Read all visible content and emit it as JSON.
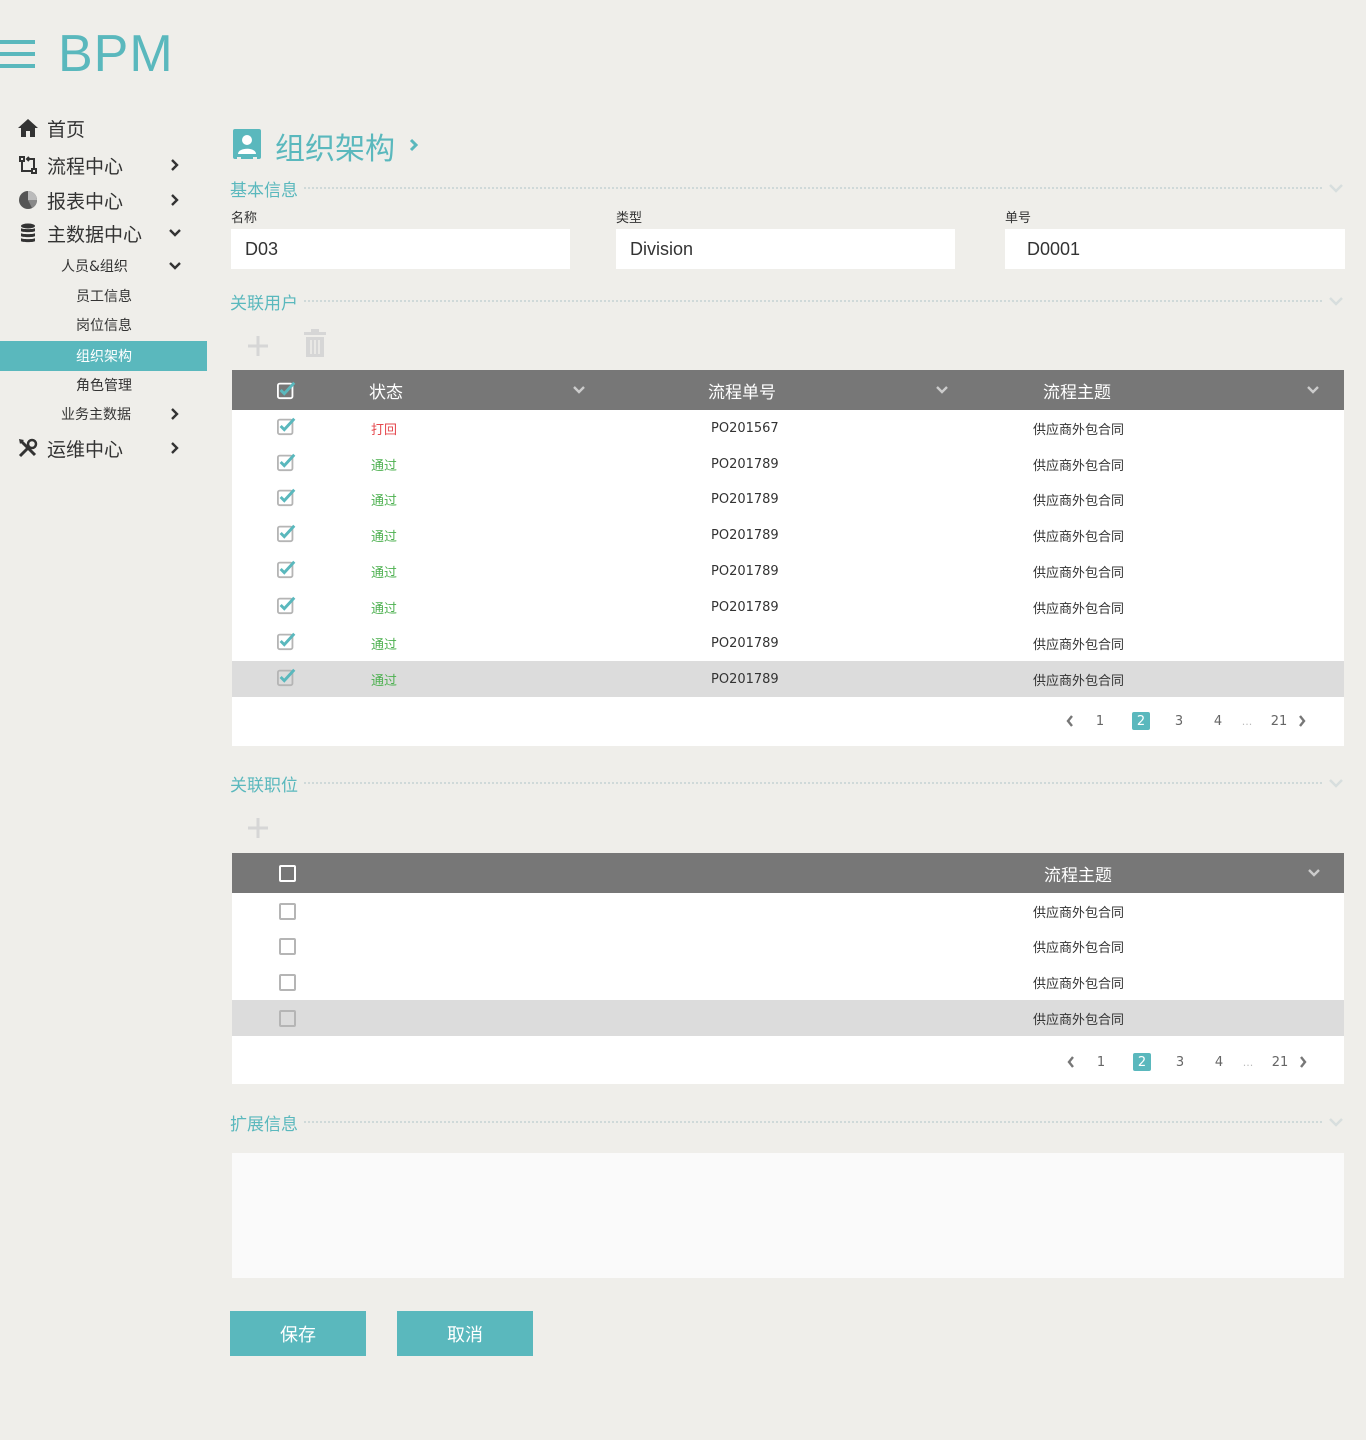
{
  "app": {
    "logo": "BPM"
  },
  "sidebar": {
    "items": [
      {
        "label": "首页",
        "icon": "home-icon"
      },
      {
        "label": "流程中心",
        "icon": "workflow-icon"
      },
      {
        "label": "报表中心",
        "icon": "pie-chart-icon"
      },
      {
        "label": "主数据中心",
        "icon": "database-icon"
      },
      {
        "label": "人员&组织"
      },
      {
        "label": "员工信息"
      },
      {
        "label": "岗位信息"
      },
      {
        "label": "组织架构",
        "active": true
      },
      {
        "label": "角色管理"
      },
      {
        "label": "业务主数据"
      },
      {
        "label": "运维中心",
        "icon": "tools-icon"
      }
    ]
  },
  "page": {
    "title": "组织架构"
  },
  "sections": {
    "basic": "基本信息",
    "users": "关联用户",
    "positions": "关联职位",
    "extension": "扩展信息"
  },
  "form": {
    "name_label": "名称",
    "name_value": "D03",
    "type_label": "类型",
    "type_value": "Division",
    "number_label": "单号",
    "number_value": "D0001"
  },
  "users_table": {
    "headers": {
      "status": "状态",
      "number": "流程单号",
      "subject": "流程主题"
    },
    "rows": [
      {
        "status": "打回",
        "status_color": "#e5484d",
        "number": "PO201567",
        "subject": "供应商外包合同",
        "checked": true
      },
      {
        "status": "通过",
        "status_color": "#4cb04f",
        "number": "PO201789",
        "subject": "供应商外包合同",
        "checked": true
      },
      {
        "status": "通过",
        "status_color": "#4cb04f",
        "number": "PO201789",
        "subject": "供应商外包合同",
        "checked": true
      },
      {
        "status": "通过",
        "status_color": "#4cb04f",
        "number": "PO201789",
        "subject": "供应商外包合同",
        "checked": true
      },
      {
        "status": "通过",
        "status_color": "#4cb04f",
        "number": "PO201789",
        "subject": "供应商外包合同",
        "checked": true
      },
      {
        "status": "通过",
        "status_color": "#4cb04f",
        "number": "PO201789",
        "subject": "供应商外包合同",
        "checked": true
      },
      {
        "status": "通过",
        "status_color": "#4cb04f",
        "number": "PO201789",
        "subject": "供应商外包合同",
        "checked": true
      },
      {
        "status": "通过",
        "status_color": "#4cb04f",
        "number": "PO201789",
        "subject": "供应商外包合同",
        "checked": true,
        "selected": true
      }
    ],
    "pagination": {
      "pages": [
        "1",
        "2",
        "3",
        "4"
      ],
      "current": "2",
      "ellipsis": "...",
      "last": "21"
    }
  },
  "positions_table": {
    "headers": {
      "subject": "流程主题"
    },
    "rows": [
      {
        "subject": "供应商外包合同",
        "checked": false
      },
      {
        "subject": "供应商外包合同",
        "checked": false
      },
      {
        "subject": "供应商外包合同",
        "checked": false
      },
      {
        "subject": "供应商外包合同",
        "checked": false,
        "selected": true
      }
    ],
    "pagination": {
      "pages": [
        "1",
        "2",
        "3",
        "4"
      ],
      "current": "2",
      "ellipsis": "...",
      "last": "21"
    }
  },
  "actions": {
    "save": "保存",
    "cancel": "取消"
  },
  "colors": {
    "accent": "#5ab8bd",
    "header_bg": "#777777",
    "page_bg": "#efeeea"
  }
}
